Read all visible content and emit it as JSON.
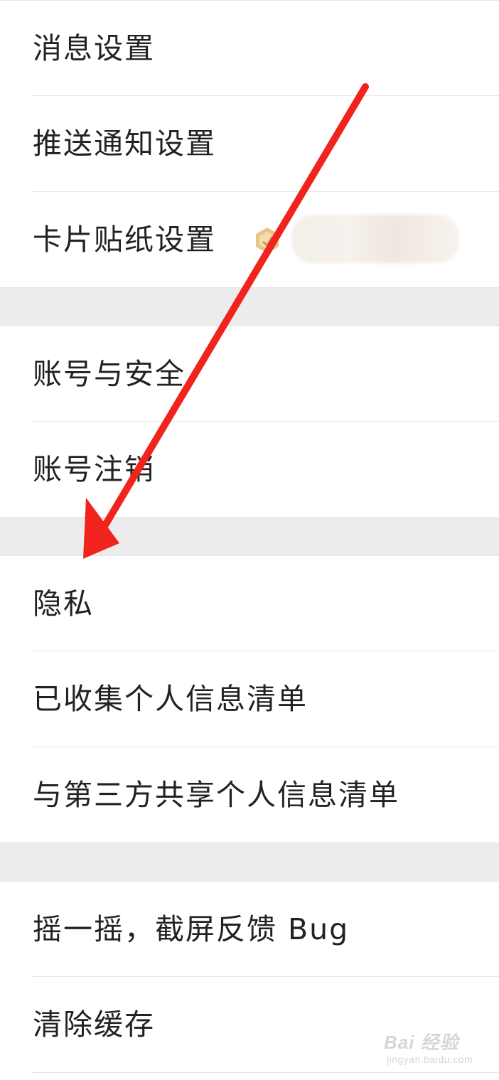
{
  "settings": {
    "group1": [
      {
        "label": "消息设置"
      },
      {
        "label": "推送通知设置"
      },
      {
        "label": "卡片贴纸设置"
      }
    ],
    "group2": [
      {
        "label": "账号与安全"
      },
      {
        "label": "账号注销"
      }
    ],
    "group3": [
      {
        "label": "隐私"
      },
      {
        "label": "已收集个人信息清单"
      },
      {
        "label": "与第三方共享个人信息清单"
      }
    ],
    "group4": [
      {
        "label": "摇一摇，截屏反馈 Bug"
      },
      {
        "label": "清除缓存"
      }
    ]
  },
  "badge_icon": "gold-hexagon-badge-icon",
  "annotation": {
    "arrow_color": "#f0241c"
  },
  "watermark": {
    "main": "Bai 经验",
    "sub": "jingyan.baidu.com"
  },
  "colors": {
    "background": "#ffffff",
    "section_gap": "#ececec",
    "divider": "#e6e6e6",
    "text": "#222222",
    "badge": "#e0b978"
  }
}
